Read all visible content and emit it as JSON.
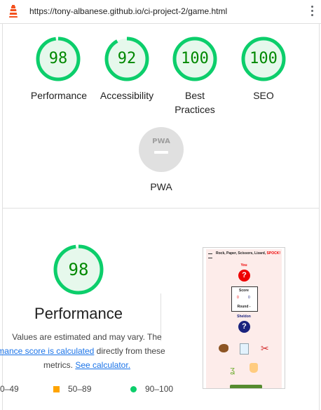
{
  "browser": {
    "url": "https://tony-albanese.github.io/ci-project-2/game.html"
  },
  "scores": [
    {
      "label": "Performance",
      "value": "98",
      "score": 98
    },
    {
      "label": "Accessibility",
      "value": "92",
      "score": 92
    },
    {
      "label": "Best Practices",
      "value": "100",
      "score": 100
    },
    {
      "label": "SEO",
      "value": "100",
      "score": 100
    }
  ],
  "pwa": {
    "label": "PWA",
    "badge_text": "PWA"
  },
  "detail": {
    "score": "98",
    "score_value": 98,
    "title": "Performance",
    "desc_line1": "Values are estimated and may vary. The",
    "desc_link1": "rmance score is calculated",
    "desc_line2_rest": " directly from these",
    "desc_line3": "metrics. ",
    "desc_link2": "See calculator."
  },
  "legend": [
    {
      "label": "0–49",
      "color": "#ff4e42"
    },
    {
      "label": "50–89",
      "color": "#ffa400"
    },
    {
      "label": "90–100",
      "color": "#0cce6b"
    }
  ],
  "thumbnail": {
    "title": "Rock, Paper, Scissors, Lizard, ",
    "title_highlight": "SPOCK!",
    "you_label": "You",
    "score_label": "Score",
    "score_left": "0",
    "score_right": "0",
    "round_label": "Round -",
    "sheldon_label": "Sheldon"
  },
  "colors": {
    "pass": "#0cce6b",
    "pass_text": "#008800",
    "pass_bg": "#e6f8ec",
    "average": "#ffa400",
    "fail": "#ff4e42",
    "link": "#1a73e8"
  }
}
